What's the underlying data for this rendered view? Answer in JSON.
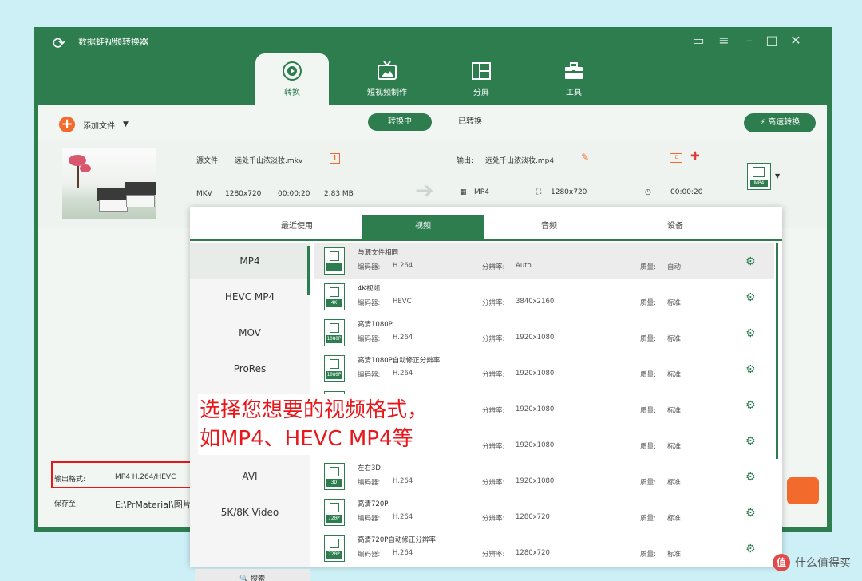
{
  "app": {
    "title": "数据蛙视频转换器",
    "window_controls": [
      "feedback-icon",
      "menu-icon",
      "minimize-icon",
      "maximize-icon",
      "close-icon"
    ]
  },
  "tabs": [
    {
      "label": "转换",
      "icon": "convert-icon",
      "active": true
    },
    {
      "label": "短视频制作",
      "icon": "tv-icon",
      "active": false
    },
    {
      "label": "分屏",
      "icon": "split-icon",
      "active": false
    },
    {
      "label": "工具",
      "icon": "toolbox-icon",
      "active": false
    }
  ],
  "toolbar": {
    "add_label": "添加文件",
    "converting_label": "转换中",
    "converted_label": "已转换",
    "fast_convert_label": "高速转换"
  },
  "file": {
    "src_label": "源文件:",
    "src_name": "远处千山浓淡妆.mkv",
    "format": "MKV",
    "resolution": "1280x720",
    "duration": "00:00:20",
    "size": "2.83 MB",
    "out_label": "输出:",
    "out_name": "远处千山浓淡妆.mp4",
    "out_format": "MP4",
    "out_resolution": "1280x720",
    "out_duration": "00:00:20",
    "out_badge": "MP4"
  },
  "bottom": {
    "out_fmt_label": "输出格式:",
    "out_fmt_value": "MP4 H.264/HEVC",
    "save_label": "保存至:",
    "save_value": "E:\\PrMaterial\\图片"
  },
  "panel": {
    "tabs": [
      "最近使用",
      "视频",
      "音频",
      "设备"
    ],
    "active_tab": "视频",
    "formats": [
      "MP4",
      "HEVC MP4",
      "MOV",
      "ProRes",
      "",
      "",
      "AVI",
      "5K/8K Video"
    ],
    "search_label": "搜索",
    "presets": [
      {
        "name": "与源文件相同",
        "badge": "",
        "codec": "H.264",
        "res": "Auto",
        "quality": "自动"
      },
      {
        "name": "4K视频",
        "badge": "4K",
        "codec": "HEVC",
        "res": "3840x2160",
        "quality": "标准"
      },
      {
        "name": "高清1080P",
        "badge": "1080P",
        "codec": "H.264",
        "res": "1920x1080",
        "quality": "标准"
      },
      {
        "name": "高清1080P自动修正分辨率",
        "badge": "1080P",
        "codec": "H.264",
        "res": "1920x1080",
        "quality": "标准"
      },
      {
        "name": "",
        "badge": "",
        "codec": "",
        "res": "1920x1080",
        "quality": "标准"
      },
      {
        "name": "",
        "badge": "",
        "codec": "",
        "res": "1920x1080",
        "quality": "标准"
      },
      {
        "name": "左右3D",
        "badge": "3D",
        "codec": "H.264",
        "res": "1920x1080",
        "quality": "标准"
      },
      {
        "name": "高清720P",
        "badge": "720P",
        "codec": "H.264",
        "res": "1280x720",
        "quality": "标准"
      },
      {
        "name": "高清720P自动修正分辨率",
        "badge": "720P",
        "codec": "H.264",
        "res": "1280x720",
        "quality": "标准"
      }
    ],
    "codec_label": "编码器:",
    "res_label": "分辨率:",
    "quality_label": "质量:"
  },
  "annotation": {
    "line1": "选择您想要的视频格式，",
    "line2": "如MP4、HEVC MP4等"
  },
  "watermark": {
    "text": "什么值得买",
    "logo": "值"
  }
}
